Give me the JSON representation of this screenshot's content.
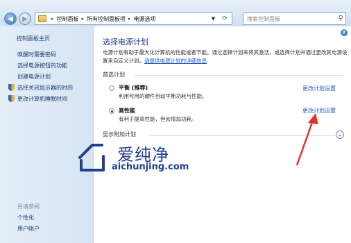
{
  "address_bar": {
    "breadcrumbs": [
      "控制面板",
      "所有控制面板项",
      "电源选项"
    ],
    "search_placeholder": "搜索控制面板"
  },
  "sidebar": {
    "home": "控制面板主页",
    "items": [
      {
        "label": "唤醒时需要密码",
        "icon": ""
      },
      {
        "label": "选择电源按钮的功能",
        "icon": ""
      },
      {
        "label": "创建电源计划",
        "icon": ""
      },
      {
        "label": "选择关闭显示器的时间",
        "icon": "uac-shield-icon"
      },
      {
        "label": "更改计算机睡眠时间",
        "icon": "uac-shield-icon"
      }
    ],
    "see_also_title": "另请参阅",
    "see_also": [
      {
        "label": "个性化"
      },
      {
        "label": "用户帐户"
      }
    ]
  },
  "main": {
    "title": "选择电源计划",
    "description": "电源计划有助于最大化计算机的性能或者节能。通过选择计划来将其激活，或选择计划并通过更改其电源设置来自定义计划。",
    "description_link": "请提供电源计划的详细信息",
    "preferred_group": "首选计划",
    "plans": [
      {
        "name": "平衡 (推荐)",
        "desc": "利用可用的硬件自动平衡功耗与性能。",
        "link": "更改计划设置",
        "selected": false
      },
      {
        "name": "高性能",
        "desc": "有利于提高性能，但会增加功耗。",
        "link": "更改计划设置",
        "selected": true
      }
    ],
    "additional_plans": "显示附加计划"
  },
  "watermark": {
    "title": "爱纯净",
    "url": "aichunjing.com"
  },
  "colors": {
    "link": "#1f5cb8",
    "title": "#1e3f8a",
    "annotation_arrow": "#e0322c"
  }
}
